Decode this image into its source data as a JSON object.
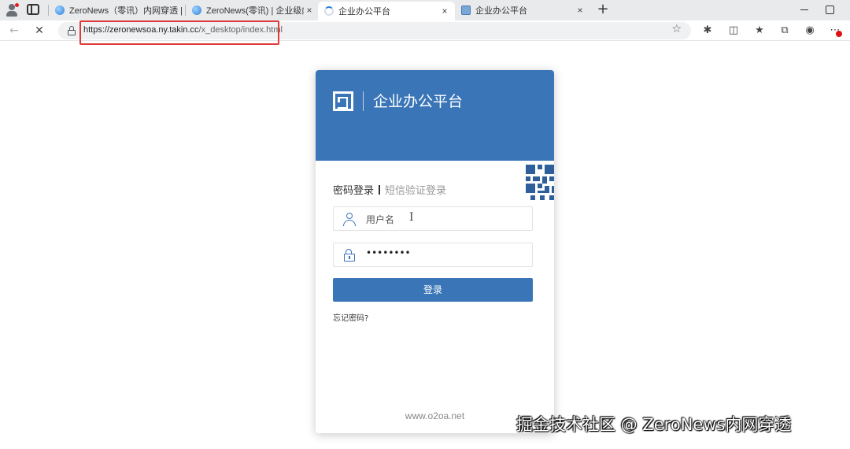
{
  "browser": {
    "tabs": [
      {
        "title": "ZeroNews（零讯）内网穿透 | 企",
        "favicon": "globe-icon",
        "active": false
      },
      {
        "title": "ZeroNews(零讯) | 企业级内网穿",
        "favicon": "globe-icon",
        "active": false
      },
      {
        "title": "企业办公平台",
        "favicon": "loading-icon",
        "active": true
      },
      {
        "title": "企业办公平台",
        "favicon": "page-icon",
        "active": false
      }
    ],
    "new_tab_label": "+",
    "close_glyph": "×",
    "address": {
      "host": "https://zeronewsoa.ny.takin.cc",
      "path": "/x_desktop/index.html"
    },
    "highlight_color": "#e03a3a"
  },
  "login": {
    "platform_name": "企业办公平台",
    "tab_password": "密码登录",
    "tab_sms": "短信验证登录",
    "username_placeholder": "用户名",
    "password_value": "••••••••",
    "login_button": "登录",
    "forgot_password": "忘记密码?",
    "footer_site": "www.o2oa.net",
    "accent_color": "#3a75b7"
  },
  "watermark": "掘金技术社区 @ ZeroNews内网穿透"
}
